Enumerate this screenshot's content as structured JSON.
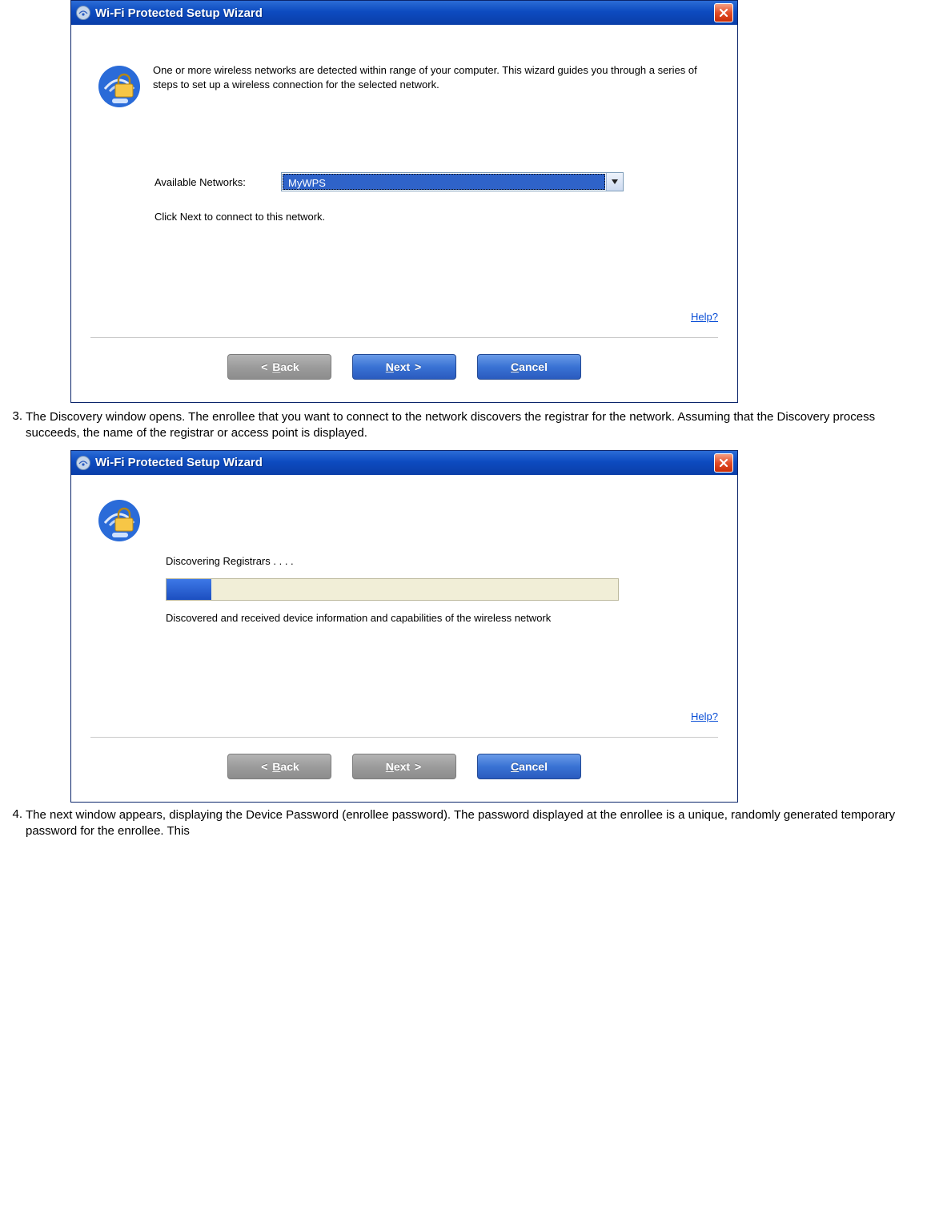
{
  "dialog1": {
    "title": "Wi-Fi Protected Setup Wizard",
    "intro": "One or more wireless networks are detected within range of your computer. This wizard guides you through a series of steps to set up a wireless connection for the selected network.",
    "available_label": "Available Networks:",
    "network_value": "MyWPS",
    "hint": "Click Next to connect to this network.",
    "help": "Help?",
    "back": "Back",
    "next": "Next",
    "cancel": "Cancel"
  },
  "step3": {
    "num": "3.",
    "text": "The Discovery window opens. The enrollee that you want to connect to the network discovers the registrar for the network. Assuming that the Discovery process succeeds, the name of the registrar or access point is displayed."
  },
  "dialog2": {
    "title": "Wi-Fi Protected Setup Wizard",
    "discovering": "Discovering Registrars . . . .",
    "progress_percent": 10,
    "status": "Discovered and received device information and capabilities of the wireless network",
    "help": "Help?",
    "back": "Back",
    "next": "Next",
    "cancel": "Cancel"
  },
  "step4": {
    "num": "4.",
    "text": "The next window appears, displaying the Device Password (enrollee password). The password displayed at the enrollee is a unique, randomly generated temporary password for the enrollee. This"
  }
}
